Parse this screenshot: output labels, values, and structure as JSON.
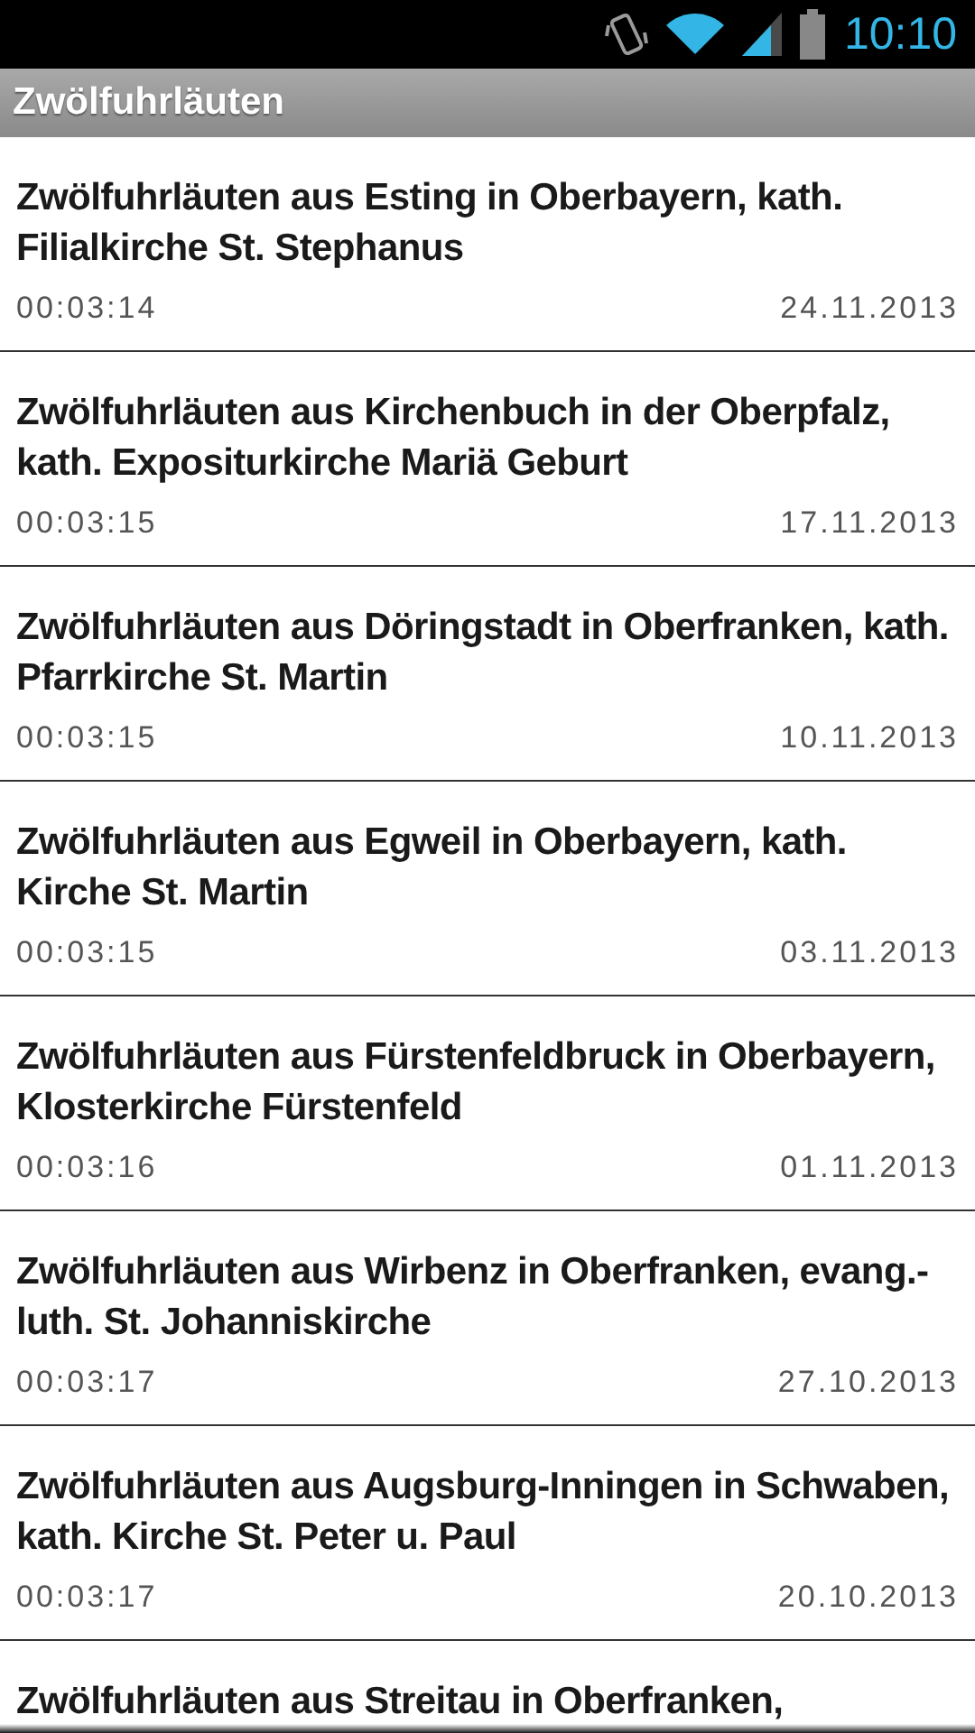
{
  "status_bar": {
    "time": "10:10"
  },
  "action_bar": {
    "title": "Zwölfuhrläuten"
  },
  "items": [
    {
      "title": "Zwölfuhrläuten aus Esting in Oberbayern, kath. Filialkirche St. Stephanus",
      "duration": "00:03:14",
      "date": "24.11.2013"
    },
    {
      "title": "Zwölfuhrläuten aus Kirchenbuch in der Oberpfalz, kath. Expositurkirche Mariä Geburt",
      "duration": "00:03:15",
      "date": "17.11.2013"
    },
    {
      "title": "Zwölfuhrläuten aus Döringstadt in Oberfranken, kath. Pfarrkirche St. Martin",
      "duration": "00:03:15",
      "date": "10.11.2013"
    },
    {
      "title": "Zwölfuhrläuten aus Egweil in Oberbayern, kath. Kirche St. Martin",
      "duration": "00:03:15",
      "date": "03.11.2013"
    },
    {
      "title": "Zwölfuhrläuten aus Fürstenfeldbruck in Oberbayern, Klosterkirche Fürstenfeld",
      "duration": "00:03:16",
      "date": "01.11.2013"
    },
    {
      "title": "Zwölfuhrläuten aus Wirbenz in Oberfranken, evang.-luth. St. Johanniskirche",
      "duration": "00:03:17",
      "date": "27.10.2013"
    },
    {
      "title": "Zwölfuhrläuten aus Augsburg-Inningen in Schwaben, kath. Kirche St. Peter u. Paul",
      "duration": "00:03:17",
      "date": "20.10.2013"
    },
    {
      "title": "Zwölfuhrläuten aus Streitau in Oberfranken,"
    }
  ]
}
